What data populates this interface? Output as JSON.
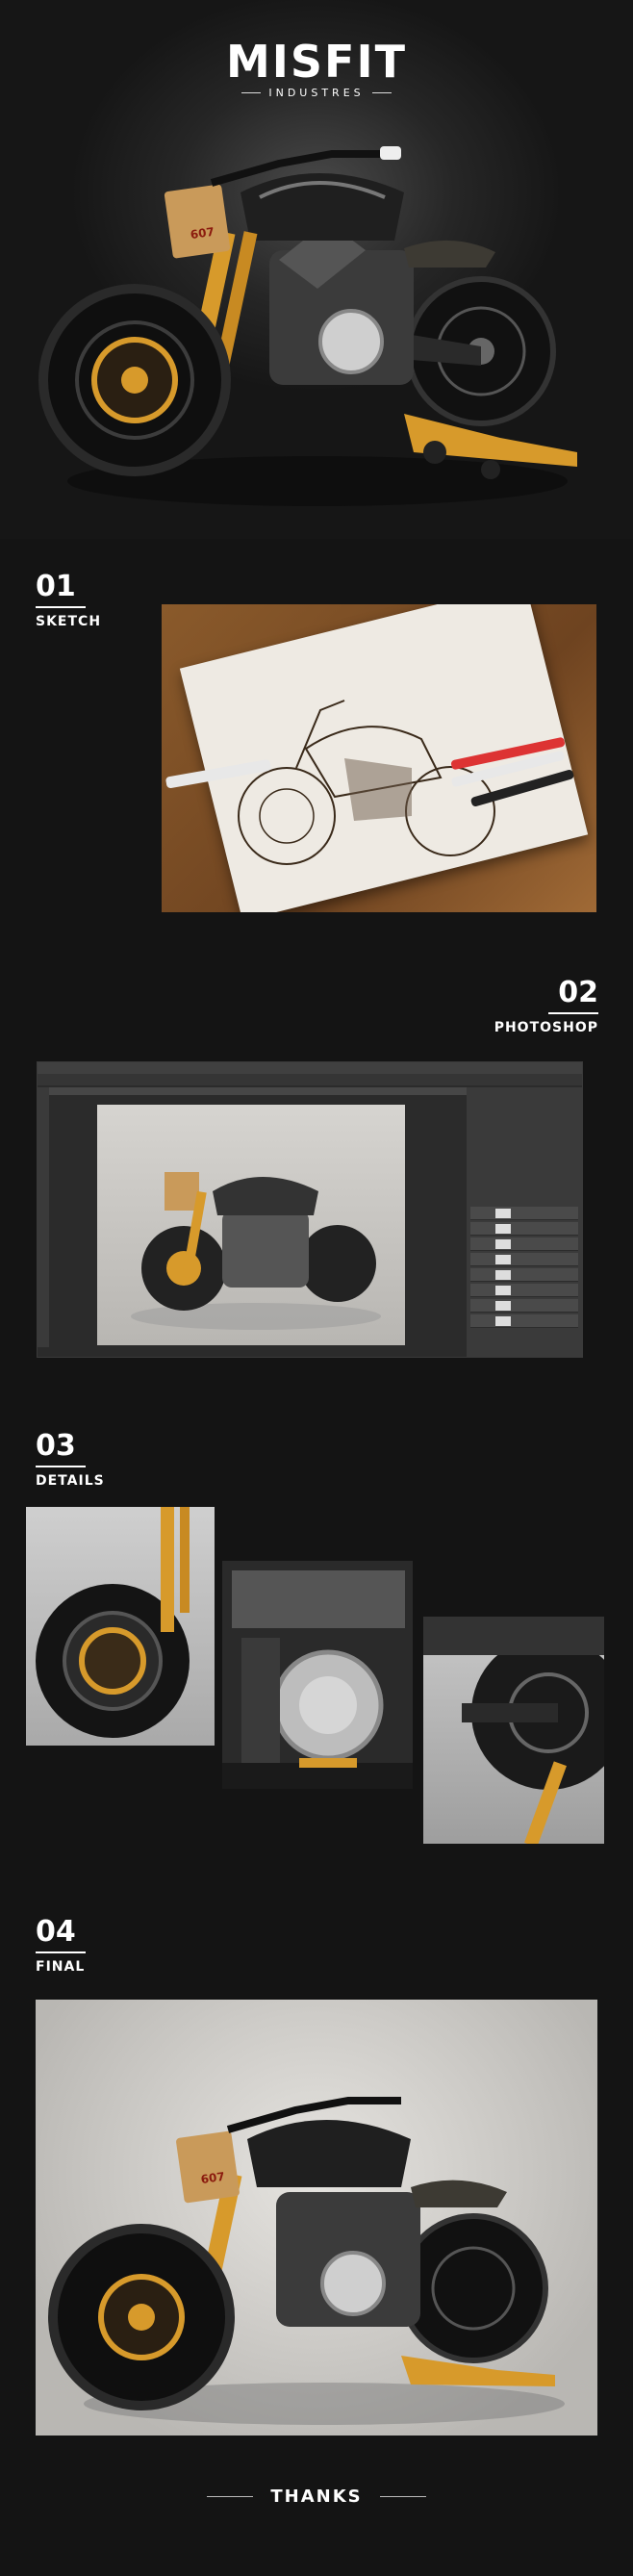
{
  "hero": {
    "logo_title": "MISFIT",
    "logo_subtitle": "INDUSTRES"
  },
  "sections": [
    {
      "num": "01",
      "label": "SKETCH"
    },
    {
      "num": "02",
      "label": "PHOTOSHOP"
    },
    {
      "num": "03",
      "label": "DETAILS"
    },
    {
      "num": "04",
      "label": "FINAL"
    }
  ],
  "footer": {
    "thanks": "THANKS"
  },
  "colors": {
    "background": "#141414",
    "accent_gold": "#d79a2b",
    "bike_black": "#1e1e1e"
  }
}
